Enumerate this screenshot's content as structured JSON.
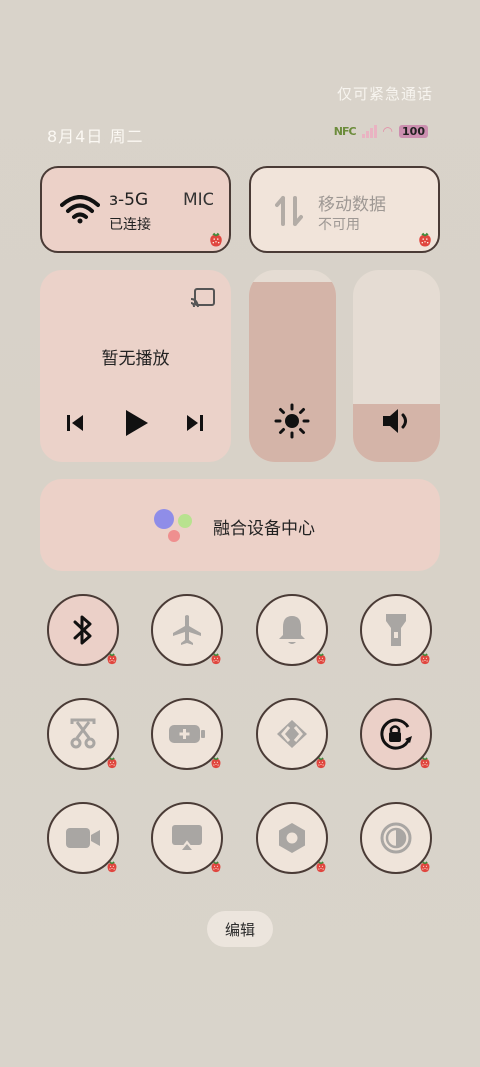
{
  "status": {
    "emergency": "仅可紧急通话",
    "date": "8月4日 周二",
    "nfc": "NFC",
    "battery": "100"
  },
  "tiles": {
    "wifi": {
      "ssid": "ɜ-5G",
      "ssid2": "MIC",
      "state": "已连接"
    },
    "mobile_data": {
      "title": "移动数据",
      "state": "不可用"
    },
    "media": {
      "title": "暂无播放"
    },
    "brightness_level": 0.94,
    "volume_level": 0.3,
    "device_center": {
      "title": "融合设备中心"
    }
  },
  "toggles": [
    {
      "name": "bluetooth",
      "on": true
    },
    {
      "name": "airplane",
      "on": false
    },
    {
      "name": "bell",
      "on": false
    },
    {
      "name": "flashlight",
      "on": false
    },
    {
      "name": "screenshot",
      "on": false
    },
    {
      "name": "battery-saver",
      "on": false
    },
    {
      "name": "nearby-share",
      "on": false
    },
    {
      "name": "rotation-lock",
      "on": true
    },
    {
      "name": "screen-record",
      "on": false
    },
    {
      "name": "screencast",
      "on": false
    },
    {
      "name": "settings-hex",
      "on": false
    },
    {
      "name": "dark-mode",
      "on": false
    }
  ],
  "footer": {
    "edit": "编辑"
  },
  "colors": {
    "accent": "#ebd0c8",
    "border": "#4a3b36",
    "icon_gray": "#a9a6a3"
  }
}
